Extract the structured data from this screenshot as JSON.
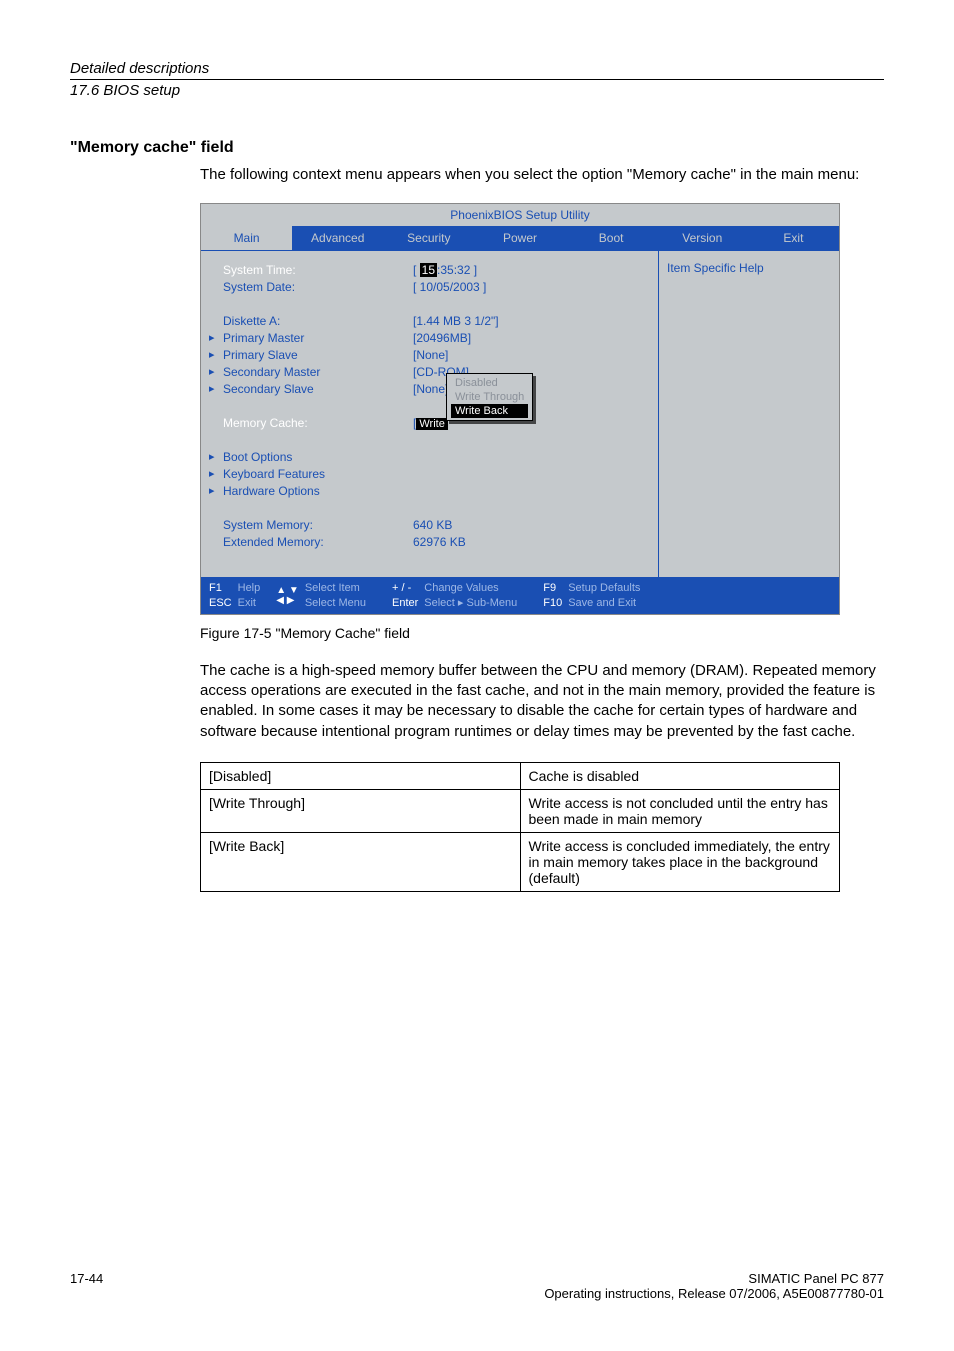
{
  "header": {
    "title": "Detailed descriptions",
    "subtitle": "17.6 BIOS setup"
  },
  "section_heading": "\"Memory cache\" field",
  "intro": "The following context menu appears when you select the option \"Memory cache\" in the main menu:",
  "bios": {
    "title": "PhoenixBIOS Setup Utility",
    "tabs": [
      "Main",
      "Advanced",
      "Security",
      "Power",
      "Boot",
      "Version",
      "Exit"
    ],
    "active_tab": "Main",
    "help_label": "Item Specific Help",
    "rows": {
      "system_time_label": "System Time:",
      "system_time_hh": "15",
      "system_time_rest": ":35:32 ]",
      "system_date_label": "System Date:",
      "system_date_val": "[ 10/05/2003 ]",
      "diskette_label": "Diskette A:",
      "diskette_val": "[1.44 MB 3 1/2\"]",
      "pm_label": "Primary Master",
      "pm_val": "[20496MB]",
      "ps_label": "Primary Slave",
      "ps_val": "[None]",
      "sm_label": "Secondary Master",
      "sm_val": "[CD-ROM]",
      "ss_label": "Secondary Slave",
      "ss_val": "[None]",
      "mc_label": "Memory Cache:",
      "mc_val_chip": "Write",
      "boot_label": "Boot Options",
      "kbd_label": "Keyboard Features",
      "hw_label": "Hardware Options",
      "sysmem_label": "System Memory:",
      "sysmem_val": "640 KB",
      "extmem_label": "Extended Memory:",
      "extmem_val": "62976 KB"
    },
    "popup": {
      "o1": "Disabled",
      "o2": "Write Through",
      "o3": "Write Back"
    },
    "footer": {
      "f1": "F1",
      "esc": "ESC",
      "help": "Help",
      "exit": "Exit",
      "sel_item": "Select Item",
      "sel_menu": "Select Menu",
      "pm": "+ / -",
      "enter": "Enter",
      "chg": "Change Values",
      "sub": "Select   ▸  Sub-Menu",
      "f9": "F9",
      "f10": "F10",
      "setup_def": "Setup Defaults",
      "save_exit": "Save and Exit"
    }
  },
  "figure_caption": "Figure 17-5    \"Memory Cache\" field",
  "after_para": "The cache is a high-speed memory buffer between the CPU and memory (DRAM). Repeated memory access operations are executed in the fast cache, and not in the main memory, provided the feature is enabled. In some cases it may be necessary to disable the cache for certain types of hardware and software because intentional program runtimes or delay times may be prevented by the fast cache.",
  "table": [
    {
      "k": "[Disabled]",
      "v": "Cache is disabled"
    },
    {
      "k": "[Write Through]",
      "v": "Write access is not concluded until the entry has been made in main memory"
    },
    {
      "k": "[Write Back]",
      "v": "Write access is concluded immediately, the entry in main memory takes place in the background (default)"
    }
  ],
  "footer": {
    "page": "17-44",
    "r1": "SIMATIC Panel PC 877",
    "r2": "Operating instructions, Release 07/2006, A5E00877780-01"
  }
}
